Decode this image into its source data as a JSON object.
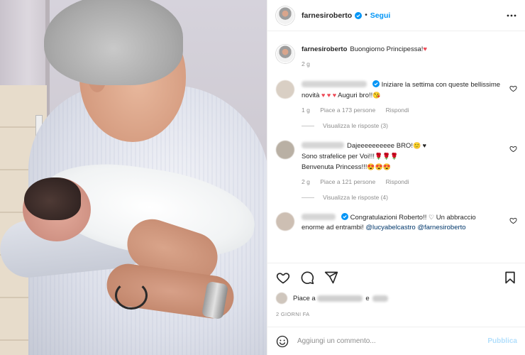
{
  "header": {
    "username": "farnesiroberto",
    "separator": "•",
    "follow_label": "Segui"
  },
  "caption": {
    "username": "farnesiroberto",
    "text": "Buongiorno Principessa!",
    "emoji": "♥",
    "time": "2 g"
  },
  "comments": [
    {
      "text_line1": "Iniziare la settima con queste bellissime",
      "text_line2": "novità",
      "emoji_hearts": "♥ ♥ ♥",
      "text_line2_tail": " Auguri bro!!",
      "emoji_tail": "😘",
      "time": "1 g",
      "likes": "Piace a 173 persone",
      "reply": "Rispondi",
      "view_replies": "Visualizza le risposte (3)"
    },
    {
      "text_line1": "Dajeeeeeeeeee BRO!",
      "text_line1_emoji": "🙂 ♥",
      "text_line2": "Sono strafelice per Voi!!!",
      "text_line2_emoji": "🌹🌹🌹",
      "text_line3": "Benvenuta Princess!!!",
      "text_line3_emoji": "😍😍😍",
      "time": "2 g",
      "likes": "Piace a 121 persone",
      "reply": "Rispondi",
      "view_replies": "Visualizza le risposte (4)"
    },
    {
      "text_line1": "Congratulazioni Roberto!!",
      "text_line1_emoji": "♡",
      "text_line1_tail": " Un abbraccio",
      "text_line2": "enorme ad entrambi!",
      "mention1": "@lucyabelcastro",
      "mention2": "@farnesiroberto"
    }
  ],
  "likes_line": {
    "prefix": "Piace a"
  },
  "date": "2 GIORNI FA",
  "add_comment": {
    "placeholder": "Aggiungi un commento...",
    "publish_label": "Pubblica"
  },
  "icons": [
    "verified-icon",
    "more-options-icon",
    "heart-icon",
    "comment-icon",
    "share-icon",
    "bookmark-icon",
    "emoji-icon"
  ],
  "colors": {
    "link_blue": "#0095f6",
    "publish_disabled": "#b2dffc",
    "heart_red": "#ed4956",
    "text": "#262626",
    "muted": "#8e8e8e"
  }
}
